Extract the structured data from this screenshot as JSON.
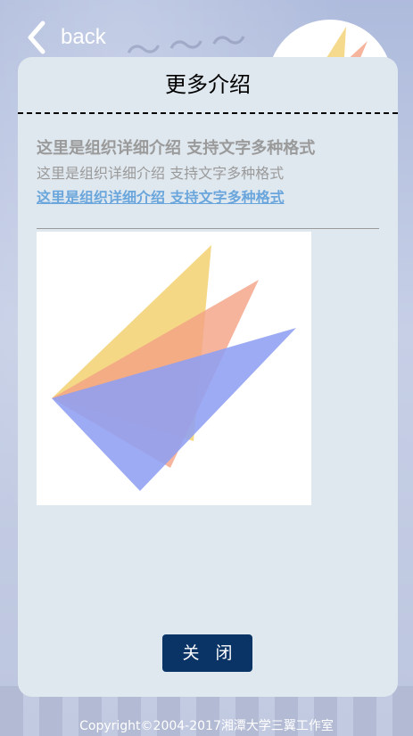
{
  "header": {
    "back_label": "back"
  },
  "card": {
    "title": "更多介绍",
    "intro_bold": "这里是组织详细介绍 支持文字多种格式",
    "intro_plain": "这里是组织详细介绍 支持文字多种格式",
    "intro_link": "这里是组织详细介绍 支持文字多种格式",
    "close_label": "关 闭"
  },
  "footer": {
    "copyright": "Copyright©2004-2017湘潭大学三翼工作室"
  },
  "colors": {
    "card_background": "#e0e8ef",
    "close_button": "#0a3366",
    "link_text": "#6aa6dc",
    "muted_text": "#9a9a9a",
    "logo_yellow": "#f3d479",
    "logo_salmon": "#f4a185",
    "logo_blue": "#8f9ff2"
  },
  "icons": {
    "back": "chevron-left-icon",
    "logo": "triangles-logo"
  }
}
